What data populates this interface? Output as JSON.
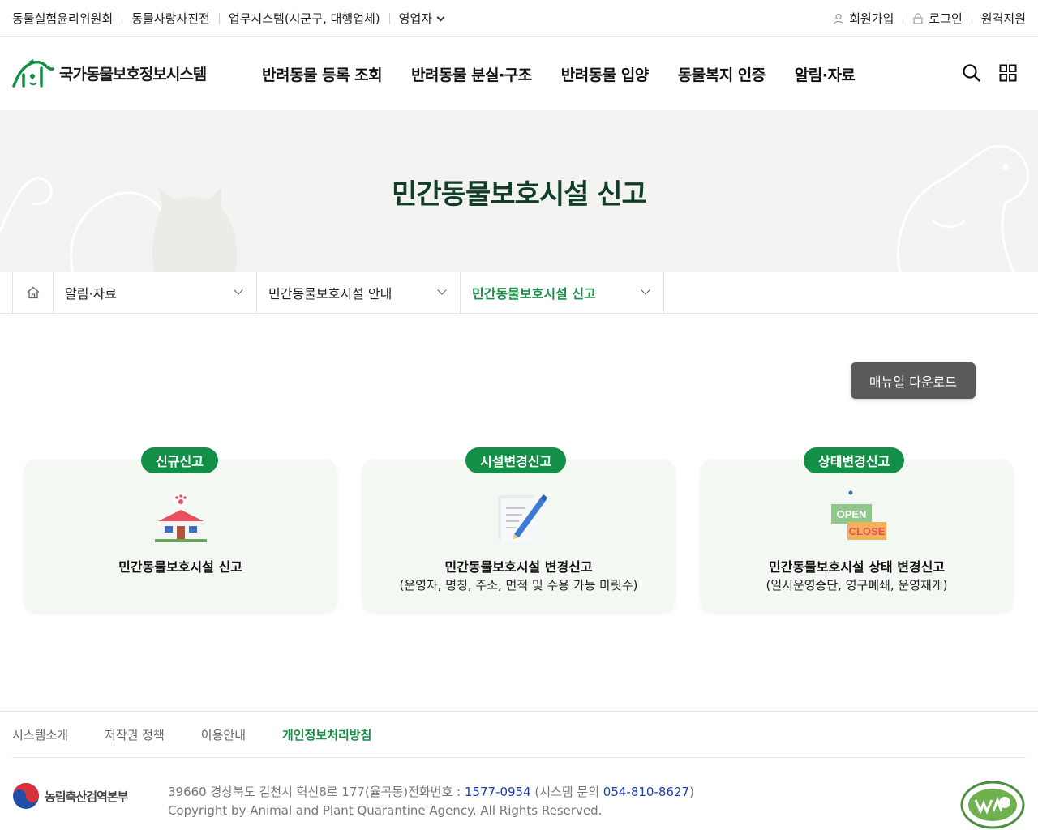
{
  "util_left": [
    {
      "label": "동물실험윤리위원회"
    },
    {
      "label": "동물사랑사진전"
    },
    {
      "label": "업무시스템(시군구, 대행업체)"
    },
    {
      "label": "영업자"
    }
  ],
  "util_right": {
    "join": "회원가입",
    "login": "로그인",
    "remote": "원격지원"
  },
  "logo": {
    "text": "국가동물보호정보시스템"
  },
  "gnb": [
    {
      "label": "반려동물 등록 조회"
    },
    {
      "label": "반려동물 분실·구조"
    },
    {
      "label": "반려동물 입양"
    },
    {
      "label": "동물복지 인증"
    },
    {
      "label": "알림·자료"
    }
  ],
  "banner": {
    "title": "민간동물보호시설 신고"
  },
  "breadcrumb": [
    {
      "label": "알림·자료"
    },
    {
      "label": "민간동물보호시설 안내"
    },
    {
      "label": "민간동물보호시설 신고"
    }
  ],
  "manual_button": "매뉴얼 다운로드",
  "cards": [
    {
      "badge": "신규신고",
      "title": "민간동물보호시설 신고",
      "sub": ""
    },
    {
      "badge": "시설변경신고",
      "title": "민간동물보호시설 변경신고",
      "sub": "(운영자, 명칭, 주소, 면적 및 수용 가능 마릿수)"
    },
    {
      "badge": "상태변경신고",
      "title": "민간동물보호시설 상태 변경신고",
      "sub": "(일시운영중단, 영구폐쇄, 운영재개)",
      "icon_text_open": "OPEN",
      "icon_text_close": "CLOSE"
    }
  ],
  "footer": {
    "links": [
      "시스템소개",
      "저작권 정책",
      "이용안내",
      "개인정보처리방침"
    ],
    "agency": "농림축산검역본부",
    "address": "39660 경상북도 김천시 혁신8로 177(율곡동)전화번호 : ",
    "phone": "1577-0954",
    "system_prefix": " (시스템 문의 ",
    "system_phone": "054-810-8627",
    "system_suffix": ")",
    "copyright": "Copyright by Animal and Plant Quarantine Agency. All Rights Reserved."
  },
  "colors": {
    "brand_green": "#148f48",
    "dark_green": "#103c28",
    "link_blue": "#1a3fb0"
  }
}
